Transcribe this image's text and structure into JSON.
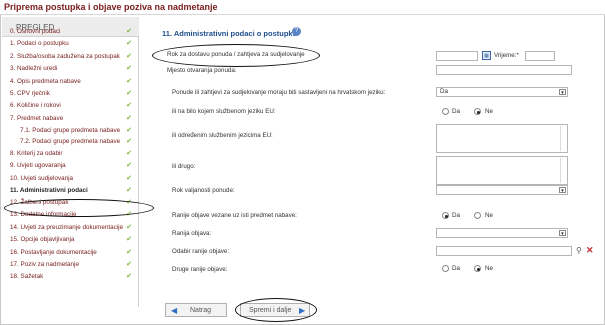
{
  "title": "Priprema postupka i objave poziva na nadmetanje",
  "sidebar": {
    "header": "PREGLED",
    "items": [
      {
        "label": "0. Osnovni podaci",
        "checked": true
      },
      {
        "label": "1. Podaci o postupku",
        "checked": true
      },
      {
        "label": "2. Služba/osoba zadužena za postupak",
        "checked": true
      },
      {
        "label": "3. Nadležni uredi",
        "checked": true
      },
      {
        "label": "4. Opis predmeta nabave",
        "checked": true
      },
      {
        "label": "5. CPV rječnik",
        "checked": true
      },
      {
        "label": "6. Količine i rokovi",
        "checked": true
      },
      {
        "label": "7. Predmet nabave",
        "checked": true
      },
      {
        "label": "7.1. Podaci grupe predmeta nabave",
        "checked": true,
        "sub": true
      },
      {
        "label": "7.2. Podaci grupe predmeta nabave",
        "checked": true,
        "sub": true
      },
      {
        "label": "8. Kriterij za odabir",
        "checked": true
      },
      {
        "label": "9. Uvjeti ugovaranja",
        "checked": true
      },
      {
        "label": "10. Uvjeti sudjelovanja",
        "checked": true
      },
      {
        "label": "11. Administrativni podaci",
        "checked": true,
        "active": true
      },
      {
        "label": "12. Žalbeni postupak",
        "checked": true
      },
      {
        "label": "13. Dodatne informacije",
        "checked": true
      },
      {
        "label": "14. Uvjeti za preuzimanje dokumentacije",
        "checked": true
      },
      {
        "label": "15. Opcije objavljivanja",
        "checked": true
      },
      {
        "label": "16. Postavljanje dokumentacije",
        "checked": true
      },
      {
        "label": "17. Poziv za nadmetanje",
        "checked": true
      },
      {
        "label": "18. Sažetak",
        "checked": true
      }
    ]
  },
  "panel": {
    "title": "11. Administrativni podaci o postupku",
    "rok_label": "Rok za dostavu ponuda / zahtjeva za sudjelovanje",
    "rok_date": "",
    "vrijeme_label": "Vrijeme:*",
    "vrijeme_value": "",
    "mjesto_label": "Mjesto otvaranja ponuda:",
    "jezik_label": "Ponude ili zahtjevi za sudjelovanje moraju biti sastavljeni na hrvatskom jeziku:",
    "jezik_value": "Da",
    "eu_label": "ili na bilo kojem službenom jeziku EU:",
    "eu_da": "Da",
    "eu_ne": "Ne",
    "eu_selected": "Ne",
    "odredjeni_label": "ili određenim službenim jezicima EU:",
    "drugo_label": "ili drugo:",
    "rok_valjanosti_label": "Rok valjanosti ponude:",
    "ranije_objave_label": "Ranije objave vezane uz isti predmet nabave:",
    "ranije_da": "Da",
    "ranije_ne": "Ne",
    "ranije_selected": "Da",
    "ranija_objava_label": "Ranija objava:",
    "odabir_label": "Odabir ranije objave:",
    "druge_label": "Druge ranije objave:",
    "druge_da": "Da",
    "druge_ne": "Ne",
    "druge_selected": "Ne"
  },
  "buttons": {
    "back": "Natrag",
    "save": "Spremi i dalje"
  }
}
